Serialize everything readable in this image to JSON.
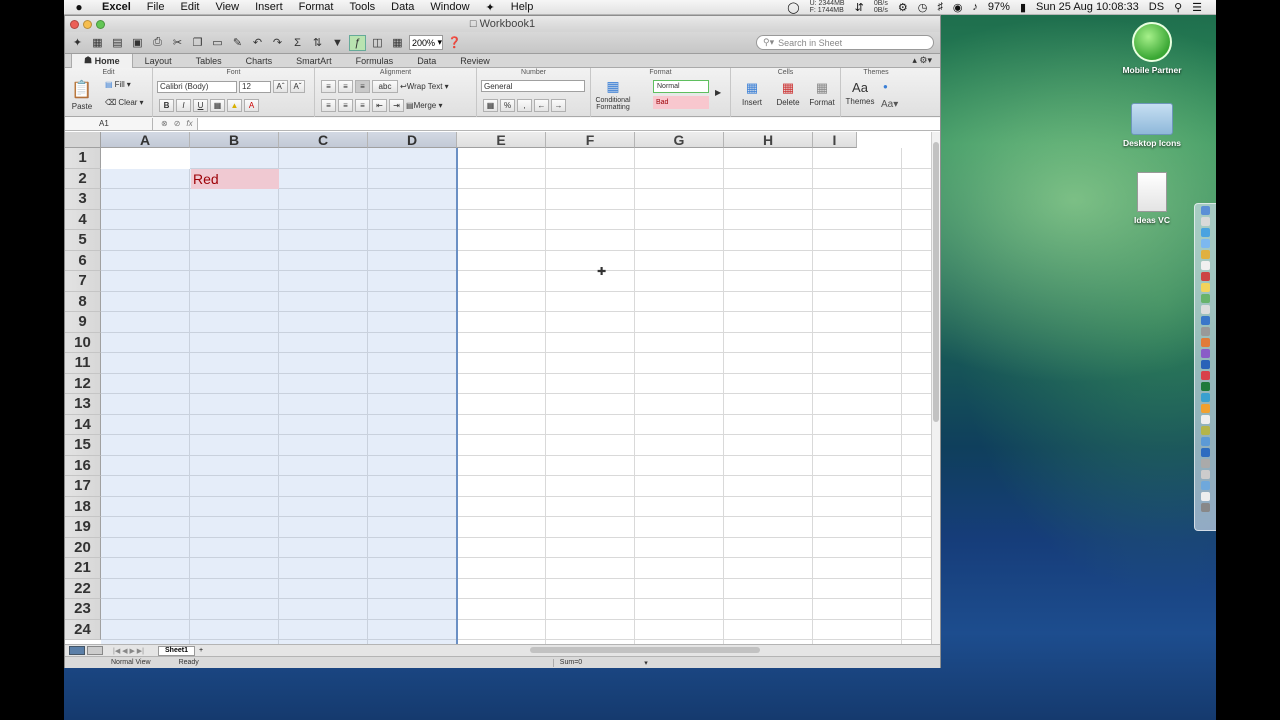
{
  "menubar": {
    "apple": "",
    "items": [
      "Excel",
      "File",
      "Edit",
      "View",
      "Insert",
      "Format",
      "Tools",
      "Data",
      "Window",
      "",
      "Help"
    ],
    "mem_used": "U: 2344MB",
    "mem_free": "F: 1744MB",
    "net_in": "0B/s",
    "net_out": "0B/s",
    "battery": "97%",
    "datetime": "Sun 25 Aug  10:08:33",
    "user": "DS"
  },
  "window": {
    "title": "Workbook1"
  },
  "toolbar": {
    "zoom": "200%",
    "search_placeholder": "Search in Sheet"
  },
  "ribbon_tabs": [
    "Home",
    "Layout",
    "Tables",
    "Charts",
    "SmartArt",
    "Formulas",
    "Data",
    "Review"
  ],
  "ribbon": {
    "edit": "Edit",
    "paste": "Paste",
    "fill": "Fill",
    "clear": "Clear",
    "font_title": "Font",
    "font_name": "Calibri (Body)",
    "font_size": "12",
    "bold": "B",
    "italic": "I",
    "underline": "U",
    "alignment_title": "Alignment",
    "abc": "abc",
    "wrap_text": "Wrap Text",
    "merge": "Merge",
    "number_title": "Number",
    "number_format": "General",
    "percent": "%",
    "comma": ",",
    "conditional_formatting": "Conditional Formatting",
    "format_title": "Format",
    "style_normal": "Normal",
    "style_bad": "Bad",
    "cells_title": "Cells",
    "insert": "Insert",
    "delete": "Delete",
    "format": "Format",
    "themes_title": "Themes",
    "themes": "Themes"
  },
  "formula_bar": {
    "name_box": "A1",
    "fx": "fx",
    "content": ""
  },
  "grid": {
    "columns": [
      "A",
      "B",
      "C",
      "D",
      "E",
      "F",
      "G",
      "H",
      "I"
    ],
    "rows": [
      "1",
      "2",
      "3",
      "4",
      "5",
      "6",
      "7",
      "8",
      "9",
      "10",
      "11",
      "12",
      "13",
      "14",
      "15",
      "16",
      "17",
      "18",
      "19",
      "20",
      "21",
      "22",
      "23",
      "24"
    ],
    "cell_b2": "Red",
    "selected_columns": [
      "A",
      "B",
      "C",
      "D"
    ]
  },
  "sheets": [
    "Sheet1"
  ],
  "statusbar": {
    "view": "Normal View",
    "ready": "Ready",
    "sum": "Sum=0"
  },
  "desktop_icons": [
    "Mobile Partner",
    "Desktop Icons",
    "Ideas VC"
  ],
  "colors": {
    "bad_fill": "#f0c9d2",
    "bad_text": "#9c0006",
    "selection": "#a0beeb"
  }
}
